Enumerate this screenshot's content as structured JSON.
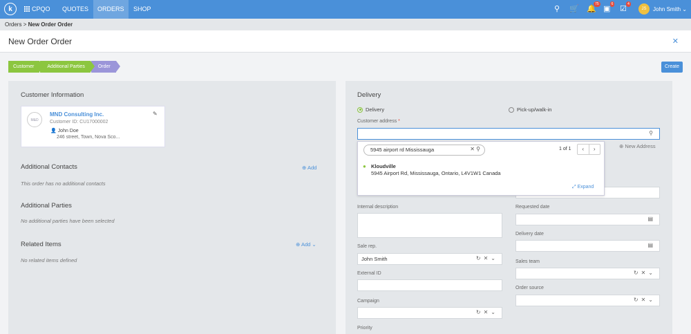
{
  "nav": {
    "logo": "k",
    "app_name": "CPQO",
    "links": [
      "QUOTES",
      "ORDERS",
      "SHOP"
    ],
    "active": "ORDERS",
    "icons": [
      "search-icon",
      "cart-icon",
      "bell-icon",
      "calendar-icon",
      "tasks-icon"
    ],
    "badges": {
      "bell": "75",
      "calendar": "6",
      "tasks": "4"
    },
    "avatar_initials": "JS",
    "user_name": "John Smith"
  },
  "breadcrumb": {
    "parent": "Orders",
    "current": "New Order Order"
  },
  "page": {
    "title": "New Order Order",
    "create_label": "Create"
  },
  "steps": [
    "Customer",
    "Additional Parties",
    "Order"
  ],
  "left": {
    "customer_info_title": "Customer Information",
    "customer": {
      "logo_text": "M&D",
      "name": "MND Consulting Inc.",
      "id": "Customer ID: CU17000002",
      "contact": "John Doe",
      "address": "246 street, Town, Nova Sco..."
    },
    "additional_contacts_title": "Additional Contacts",
    "additional_contacts_empty": "This order has no additional contacts",
    "additional_parties_title": "Additional Parties",
    "additional_parties_empty": "No additional parties have been selected",
    "related_items_title": "Related Items",
    "related_items_empty": "No related items defined",
    "add_label": "Add"
  },
  "right": {
    "delivery_title": "Delivery",
    "radio_delivery": "Delivery",
    "radio_pickup": "Pick-up/walk-in",
    "customer_address_label": "Customer address",
    "new_address_label": "New Address",
    "address_search": {
      "query": "5945 airport rd Mississauga",
      "count": "1 of 1",
      "result_name": "Kloudville",
      "result_address": "5945 Airport Rd, Mississauga, Ontario, L4V1W1 Canada",
      "expand_label": "Expand"
    },
    "internal_description_label": "Internal description",
    "requested_date_label": "Requested date",
    "delivery_date_label": "Delivery date",
    "sale_rep_label": "Sale rep.",
    "sale_rep_value": "John Smith",
    "sales_team_label": "Sales team",
    "external_id_label": "External ID",
    "order_source_label": "Order source",
    "campaign_label": "Campaign",
    "priority_label": "Priority"
  },
  "colors": {
    "nav": "#4a90d9",
    "step_done": "#8cc63f",
    "step_current": "#9b95d9",
    "accent": "#4a90d9"
  }
}
